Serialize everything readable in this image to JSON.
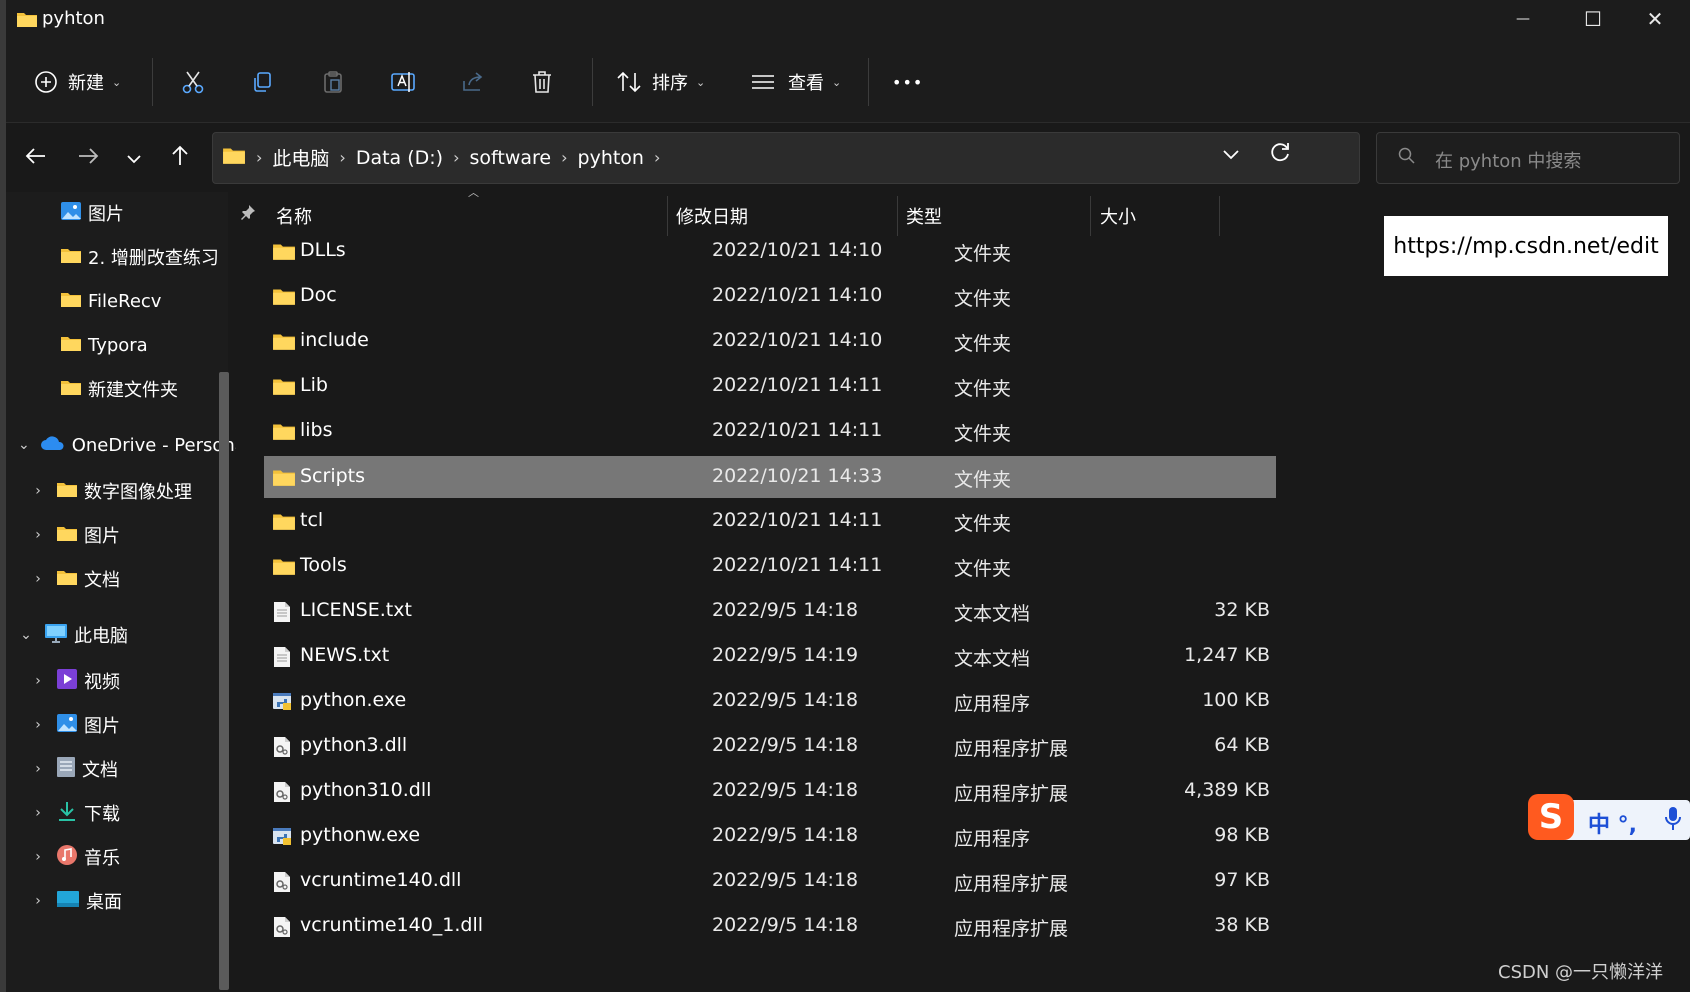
{
  "window": {
    "title": "pyhton",
    "min_glyph": "—",
    "max_glyph": "☐",
    "close_glyph": "✕"
  },
  "toolbar": {
    "new_label": "新建",
    "sort_label": "排序",
    "view_label": "查看",
    "more_label": "•••",
    "icons": [
      "cut-icon",
      "copy-icon",
      "paste-icon",
      "rename-icon",
      "share-icon",
      "delete-icon"
    ]
  },
  "address": {
    "crumbs": [
      "此电脑",
      "Data (D:)",
      "software",
      "pyhton"
    ],
    "search_placeholder": "在 pyhton 中搜索"
  },
  "sidebar": {
    "items": [
      {
        "label": "图片",
        "icon": "pictures-icon",
        "pinned": true
      },
      {
        "label": "2. 增删改查练习",
        "icon": "folder-icon"
      },
      {
        "label": "FileRecv",
        "icon": "folder-icon"
      },
      {
        "label": "Typora",
        "icon": "folder-icon"
      },
      {
        "label": "新建文件夹",
        "icon": "folder-icon"
      },
      {
        "label": "OneDrive - Personal",
        "icon": "onedrive-icon",
        "expanded": true
      },
      {
        "label": "数字图像处理",
        "icon": "folder-icon"
      },
      {
        "label": "图片",
        "icon": "folder-icon"
      },
      {
        "label": "文档",
        "icon": "folder-icon"
      },
      {
        "label": "此电脑",
        "icon": "this-pc-icon",
        "expanded": true
      },
      {
        "label": "视频",
        "icon": "videos-icon"
      },
      {
        "label": "图片",
        "icon": "pictures-icon"
      },
      {
        "label": "文档",
        "icon": "documents-icon"
      },
      {
        "label": "下载",
        "icon": "downloads-icon"
      },
      {
        "label": "音乐",
        "icon": "music-icon"
      },
      {
        "label": "桌面",
        "icon": "desktop-icon"
      }
    ]
  },
  "columns": {
    "name": "名称",
    "date": "修改日期",
    "type": "类型",
    "size": "大小"
  },
  "files": [
    {
      "name": "DLLs",
      "date": "2022/10/21 14:10",
      "type": "文件夹",
      "size": "",
      "icon": "folder-icon"
    },
    {
      "name": "Doc",
      "date": "2022/10/21 14:10",
      "type": "文件夹",
      "size": "",
      "icon": "folder-icon"
    },
    {
      "name": "include",
      "date": "2022/10/21 14:10",
      "type": "文件夹",
      "size": "",
      "icon": "folder-icon"
    },
    {
      "name": "Lib",
      "date": "2022/10/21 14:11",
      "type": "文件夹",
      "size": "",
      "icon": "folder-icon"
    },
    {
      "name": "libs",
      "date": "2022/10/21 14:11",
      "type": "文件夹",
      "size": "",
      "icon": "folder-icon"
    },
    {
      "name": "Scripts",
      "date": "2022/10/21 14:33",
      "type": "文件夹",
      "size": "",
      "icon": "folder-icon",
      "selected": true
    },
    {
      "name": "tcl",
      "date": "2022/10/21 14:11",
      "type": "文件夹",
      "size": "",
      "icon": "folder-icon"
    },
    {
      "name": "Tools",
      "date": "2022/10/21 14:11",
      "type": "文件夹",
      "size": "",
      "icon": "folder-icon"
    },
    {
      "name": "LICENSE.txt",
      "date": "2022/9/5 14:18",
      "type": "文本文档",
      "size": "32 KB",
      "icon": "text-file-icon"
    },
    {
      "name": "NEWS.txt",
      "date": "2022/9/5 14:19",
      "type": "文本文档",
      "size": "1,247 KB",
      "icon": "text-file-icon"
    },
    {
      "name": "python.exe",
      "date": "2022/9/5 14:18",
      "type": "应用程序",
      "size": "100 KB",
      "icon": "python-exe-icon"
    },
    {
      "name": "python3.dll",
      "date": "2022/9/5 14:18",
      "type": "应用程序扩展",
      "size": "64 KB",
      "icon": "dll-file-icon"
    },
    {
      "name": "python310.dll",
      "date": "2022/9/5 14:18",
      "type": "应用程序扩展",
      "size": "4,389 KB",
      "icon": "dll-file-icon"
    },
    {
      "name": "pythonw.exe",
      "date": "2022/9/5 14:18",
      "type": "应用程序",
      "size": "98 KB",
      "icon": "python-exe-icon"
    },
    {
      "name": "vcruntime140.dll",
      "date": "2022/9/5 14:18",
      "type": "应用程序扩展",
      "size": "97 KB",
      "icon": "dll-file-icon"
    },
    {
      "name": "vcruntime140_1.dll",
      "date": "2022/9/5 14:18",
      "type": "应用程序扩展",
      "size": "38 KB",
      "icon": "dll-file-icon"
    }
  ],
  "overlay": {
    "url_tooltip": "https://mp.csdn.net/edit",
    "ime_logo": "S",
    "ime_text": "中 °,",
    "watermark": "CSDN @一只懒洋洋"
  },
  "colors": {
    "background": "#191919",
    "selection": "#777777",
    "folder": "#f3c13a",
    "ime_brand": "#ff5a1f"
  }
}
